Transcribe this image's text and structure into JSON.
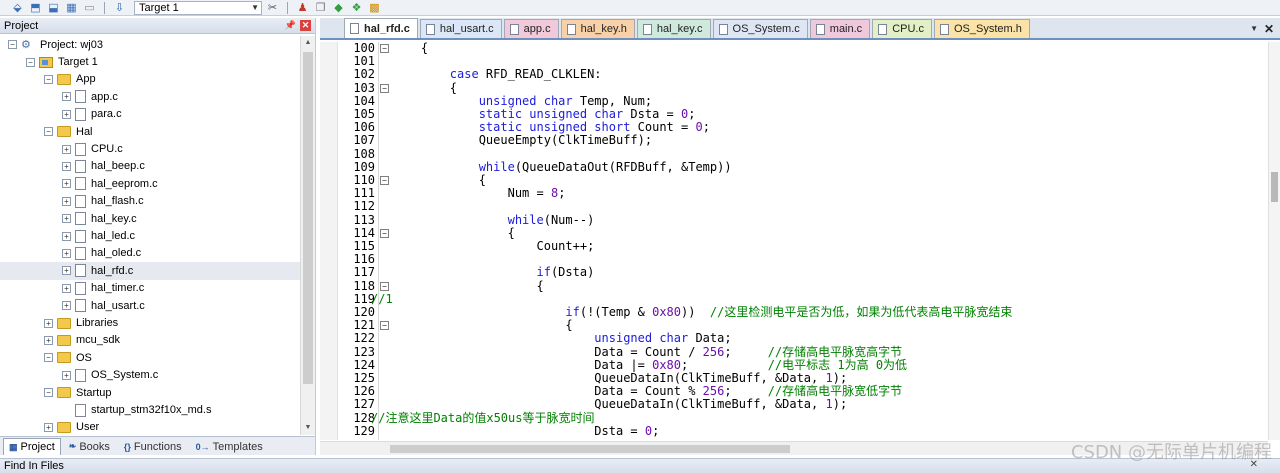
{
  "toolbar": {
    "target_label": "Target 1",
    "icons": [
      "translate-icon",
      "build-icon",
      "rebuild-icon",
      "batch-build-icon",
      "stop-build-icon",
      "download-icon",
      "options-icon",
      "manage-components-icon",
      "select-packs-icon",
      "pack-installer-icon",
      "debug-config-icon",
      "run-env-icon"
    ]
  },
  "project_panel": {
    "title": "Project",
    "tree": [
      {
        "label": "Project: wj03",
        "kind": "project",
        "level": 0,
        "expander": "-"
      },
      {
        "label": "Target 1",
        "kind": "target",
        "level": 1,
        "expander": "-"
      },
      {
        "label": "App",
        "kind": "folder",
        "level": 2,
        "expander": "-"
      },
      {
        "label": "app.c",
        "kind": "file",
        "level": 3,
        "expander": "+"
      },
      {
        "label": "para.c",
        "kind": "file",
        "level": 3,
        "expander": "+"
      },
      {
        "label": "Hal",
        "kind": "folder",
        "level": 2,
        "expander": "-"
      },
      {
        "label": "CPU.c",
        "kind": "file",
        "level": 3,
        "expander": "+"
      },
      {
        "label": "hal_beep.c",
        "kind": "file",
        "level": 3,
        "expander": "+"
      },
      {
        "label": "hal_eeprom.c",
        "kind": "file",
        "level": 3,
        "expander": "+"
      },
      {
        "label": "hal_flash.c",
        "kind": "file",
        "level": 3,
        "expander": "+"
      },
      {
        "label": "hal_key.c",
        "kind": "file",
        "level": 3,
        "expander": "+"
      },
      {
        "label": "hal_led.c",
        "kind": "file",
        "level": 3,
        "expander": "+"
      },
      {
        "label": "hal_oled.c",
        "kind": "file",
        "level": 3,
        "expander": "+"
      },
      {
        "label": "hal_rfd.c",
        "kind": "file",
        "level": 3,
        "expander": "+",
        "selected": true
      },
      {
        "label": "hal_timer.c",
        "kind": "file",
        "level": 3,
        "expander": "+"
      },
      {
        "label": "hal_usart.c",
        "kind": "file",
        "level": 3,
        "expander": "+"
      },
      {
        "label": "Libraries",
        "kind": "folder",
        "level": 2,
        "expander": "+"
      },
      {
        "label": "mcu_sdk",
        "kind": "folder",
        "level": 2,
        "expander": "+"
      },
      {
        "label": "OS",
        "kind": "folder",
        "level": 2,
        "expander": "-"
      },
      {
        "label": "OS_System.c",
        "kind": "file",
        "level": 3,
        "expander": "+"
      },
      {
        "label": "Startup",
        "kind": "folder",
        "level": 2,
        "expander": "-"
      },
      {
        "label": "startup_stm32f10x_md.s",
        "kind": "file",
        "level": 3,
        "expander": ""
      },
      {
        "label": "User",
        "kind": "folder",
        "level": 2,
        "expander": "+"
      }
    ],
    "bottom_tabs": [
      {
        "label": "Project",
        "icon": "project-tab-icon",
        "glyph": "▦",
        "active": true
      },
      {
        "label": "Books",
        "icon": "books-tab-icon",
        "glyph": "❧",
        "active": false
      },
      {
        "label": "Functions",
        "icon": "functions-tab-icon",
        "glyph": "{}",
        "active": false
      },
      {
        "label": "Templates",
        "icon": "templates-tab-icon",
        "glyph": "0→",
        "active": false
      }
    ]
  },
  "editor": {
    "tabs": [
      {
        "label": "hal_rfd.c",
        "color": "#ffffff",
        "active": true
      },
      {
        "label": "hal_usart.c",
        "color": "#dbe7f6",
        "active": false
      },
      {
        "label": "app.c",
        "color": "#f2c9d9",
        "active": false
      },
      {
        "label": "hal_key.h",
        "color": "#f9d1a8",
        "active": false
      },
      {
        "label": "hal_key.c",
        "color": "#cfe9dd",
        "active": false
      },
      {
        "label": "OS_System.c",
        "color": "#dfe6f3",
        "active": false
      },
      {
        "label": "main.c",
        "color": "#f0c8dc",
        "active": false
      },
      {
        "label": "CPU.c",
        "color": "#e3efc4",
        "active": false
      },
      {
        "label": "OS_System.h",
        "color": "#fbe2a6",
        "active": false
      }
    ],
    "close_glyph": "✕",
    "dropdown_glyph": "▼",
    "lines": [
      {
        "n": "100",
        "fold": "-",
        "code": [
          {
            "t": "    {",
            "c": ""
          }
        ]
      },
      {
        "n": "101",
        "fold": "",
        "code": [
          {
            "t": "",
            "c": ""
          }
        ]
      },
      {
        "n": "102",
        "fold": "",
        "code": [
          {
            "t": "        ",
            "c": ""
          },
          {
            "t": "case",
            "c": "kw"
          },
          {
            "t": " RFD_READ_CLKLEN:",
            "c": ""
          }
        ]
      },
      {
        "n": "103",
        "fold": "-",
        "code": [
          {
            "t": "        {",
            "c": ""
          }
        ]
      },
      {
        "n": "104",
        "fold": "",
        "code": [
          {
            "t": "            ",
            "c": ""
          },
          {
            "t": "unsigned char",
            "c": "kw"
          },
          {
            "t": " Temp, Num;",
            "c": ""
          }
        ]
      },
      {
        "n": "105",
        "fold": "",
        "code": [
          {
            "t": "            ",
            "c": ""
          },
          {
            "t": "static unsigned char",
            "c": "kw"
          },
          {
            "t": " Dsta = ",
            "c": ""
          },
          {
            "t": "0",
            "c": "num"
          },
          {
            "t": ";",
            "c": ""
          }
        ]
      },
      {
        "n": "106",
        "fold": "",
        "code": [
          {
            "t": "            ",
            "c": ""
          },
          {
            "t": "static unsigned short",
            "c": "kw"
          },
          {
            "t": " Count = ",
            "c": ""
          },
          {
            "t": "0",
            "c": "num"
          },
          {
            "t": ";",
            "c": ""
          }
        ]
      },
      {
        "n": "107",
        "fold": "",
        "code": [
          {
            "t": "            QueueEmpty(ClkTimeBuff);",
            "c": ""
          }
        ]
      },
      {
        "n": "108",
        "fold": "",
        "code": [
          {
            "t": "",
            "c": ""
          }
        ]
      },
      {
        "n": "109",
        "fold": "",
        "code": [
          {
            "t": "            ",
            "c": ""
          },
          {
            "t": "while",
            "c": "kw"
          },
          {
            "t": "(QueueDataOut(RFDBuff, &Temp))",
            "c": ""
          }
        ]
      },
      {
        "n": "110",
        "fold": "-",
        "code": [
          {
            "t": "            {",
            "c": ""
          }
        ]
      },
      {
        "n": "111",
        "fold": "",
        "code": [
          {
            "t": "                Num = ",
            "c": ""
          },
          {
            "t": "8",
            "c": "num"
          },
          {
            "t": ";",
            "c": ""
          }
        ]
      },
      {
        "n": "112",
        "fold": "",
        "code": [
          {
            "t": "",
            "c": ""
          }
        ]
      },
      {
        "n": "113",
        "fold": "",
        "code": [
          {
            "t": "                ",
            "c": ""
          },
          {
            "t": "while",
            "c": "kw"
          },
          {
            "t": "(Num--)",
            "c": ""
          }
        ]
      },
      {
        "n": "114",
        "fold": "-",
        "code": [
          {
            "t": "                {",
            "c": ""
          }
        ]
      },
      {
        "n": "115",
        "fold": "",
        "code": [
          {
            "t": "                    Count++;",
            "c": ""
          }
        ]
      },
      {
        "n": "116",
        "fold": "",
        "code": [
          {
            "t": "",
            "c": ""
          }
        ]
      },
      {
        "n": "117",
        "fold": "",
        "code": [
          {
            "t": "                    ",
            "c": ""
          },
          {
            "t": "if",
            "c": "kw"
          },
          {
            "t": "(Dsta)",
            "c": ""
          }
        ]
      },
      {
        "n": "118",
        "fold": "-",
        "code": [
          {
            "t": "                    {",
            "c": ""
          }
        ]
      },
      {
        "n": "119",
        "fold": "",
        "code": [
          {
            "t": "//1",
            "c": "cmt"
          }
        ],
        "abs": true
      },
      {
        "n": "120",
        "fold": "",
        "code": [
          {
            "t": "                        ",
            "c": ""
          },
          {
            "t": "if",
            "c": "kw"
          },
          {
            "t": "(!(Temp & ",
            "c": ""
          },
          {
            "t": "0x80",
            "c": "num"
          },
          {
            "t": "))  ",
            "c": ""
          },
          {
            "t": "//这里检测电平是否为低，如果为低代表高电平脉宽结束",
            "c": "cmt"
          }
        ]
      },
      {
        "n": "121",
        "fold": "-",
        "code": [
          {
            "t": "                        {",
            "c": ""
          }
        ]
      },
      {
        "n": "122",
        "fold": "",
        "code": [
          {
            "t": "                            ",
            "c": ""
          },
          {
            "t": "unsigned char",
            "c": "kw"
          },
          {
            "t": " Data;",
            "c": ""
          }
        ]
      },
      {
        "n": "123",
        "fold": "",
        "code": [
          {
            "t": "                            Data = Count / ",
            "c": ""
          },
          {
            "t": "256",
            "c": "num"
          },
          {
            "t": ";     ",
            "c": ""
          },
          {
            "t": "//存储高电平脉宽高字节",
            "c": "cmt"
          }
        ]
      },
      {
        "n": "124",
        "fold": "",
        "code": [
          {
            "t": "                            Data |= ",
            "c": ""
          },
          {
            "t": "0x80",
            "c": "num"
          },
          {
            "t": ";           ",
            "c": ""
          },
          {
            "t": "//电平标志 1为高 0为低",
            "c": "cmt"
          }
        ]
      },
      {
        "n": "125",
        "fold": "",
        "code": [
          {
            "t": "                            QueueDataIn(ClkTimeBuff, &Data, ",
            "c": ""
          },
          {
            "t": "1",
            "c": "num"
          },
          {
            "t": ");",
            "c": ""
          }
        ]
      },
      {
        "n": "126",
        "fold": "",
        "code": [
          {
            "t": "                            Data = Count % ",
            "c": ""
          },
          {
            "t": "256",
            "c": "num"
          },
          {
            "t": ";     ",
            "c": ""
          },
          {
            "t": "//存储高电平脉宽低字节",
            "c": "cmt"
          }
        ]
      },
      {
        "n": "127",
        "fold": "",
        "code": [
          {
            "t": "                            QueueDataIn(ClkTimeBuff, &Data, ",
            "c": ""
          },
          {
            "t": "1",
            "c": "num"
          },
          {
            "t": ");",
            "c": ""
          }
        ]
      },
      {
        "n": "128",
        "fold": "",
        "code": [
          {
            "t": "//注意这里Data的值x50us等于脉宽时间",
            "c": "cmt"
          }
        ],
        "abs": true
      },
      {
        "n": "129",
        "fold": "",
        "code": [
          {
            "t": "                            Dsta = ",
            "c": ""
          },
          {
            "t": "0",
            "c": "num"
          },
          {
            "t": ";",
            "c": ""
          }
        ]
      }
    ]
  },
  "bottom_panel": {
    "title": "Find In Files"
  },
  "watermark": "CSDN @无际单片机编程"
}
